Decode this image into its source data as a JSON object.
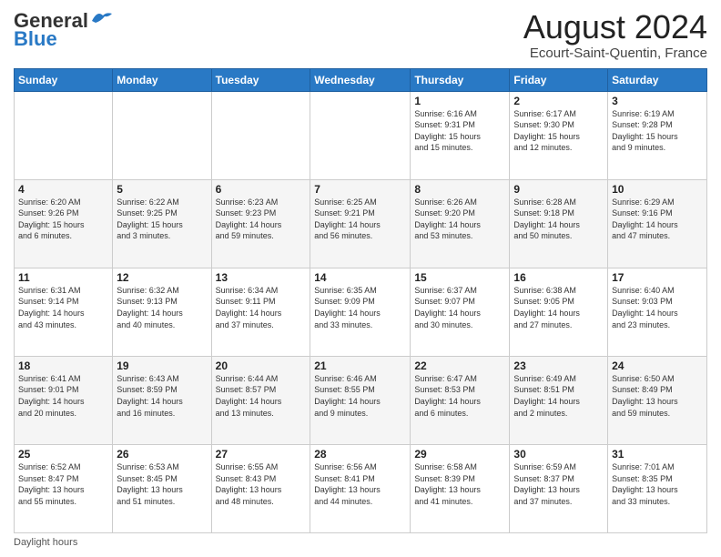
{
  "header": {
    "logo_general": "General",
    "logo_blue": "Blue",
    "month_title": "August 2024",
    "location": "Ecourt-Saint-Quentin, France"
  },
  "days_of_week": [
    "Sunday",
    "Monday",
    "Tuesday",
    "Wednesday",
    "Thursday",
    "Friday",
    "Saturday"
  ],
  "weeks": [
    [
      {
        "day": "",
        "info": ""
      },
      {
        "day": "",
        "info": ""
      },
      {
        "day": "",
        "info": ""
      },
      {
        "day": "",
        "info": ""
      },
      {
        "day": "1",
        "info": "Sunrise: 6:16 AM\nSunset: 9:31 PM\nDaylight: 15 hours\nand 15 minutes."
      },
      {
        "day": "2",
        "info": "Sunrise: 6:17 AM\nSunset: 9:30 PM\nDaylight: 15 hours\nand 12 minutes."
      },
      {
        "day": "3",
        "info": "Sunrise: 6:19 AM\nSunset: 9:28 PM\nDaylight: 15 hours\nand 9 minutes."
      }
    ],
    [
      {
        "day": "4",
        "info": "Sunrise: 6:20 AM\nSunset: 9:26 PM\nDaylight: 15 hours\nand 6 minutes."
      },
      {
        "day": "5",
        "info": "Sunrise: 6:22 AM\nSunset: 9:25 PM\nDaylight: 15 hours\nand 3 minutes."
      },
      {
        "day": "6",
        "info": "Sunrise: 6:23 AM\nSunset: 9:23 PM\nDaylight: 14 hours\nand 59 minutes."
      },
      {
        "day": "7",
        "info": "Sunrise: 6:25 AM\nSunset: 9:21 PM\nDaylight: 14 hours\nand 56 minutes."
      },
      {
        "day": "8",
        "info": "Sunrise: 6:26 AM\nSunset: 9:20 PM\nDaylight: 14 hours\nand 53 minutes."
      },
      {
        "day": "9",
        "info": "Sunrise: 6:28 AM\nSunset: 9:18 PM\nDaylight: 14 hours\nand 50 minutes."
      },
      {
        "day": "10",
        "info": "Sunrise: 6:29 AM\nSunset: 9:16 PM\nDaylight: 14 hours\nand 47 minutes."
      }
    ],
    [
      {
        "day": "11",
        "info": "Sunrise: 6:31 AM\nSunset: 9:14 PM\nDaylight: 14 hours\nand 43 minutes."
      },
      {
        "day": "12",
        "info": "Sunrise: 6:32 AM\nSunset: 9:13 PM\nDaylight: 14 hours\nand 40 minutes."
      },
      {
        "day": "13",
        "info": "Sunrise: 6:34 AM\nSunset: 9:11 PM\nDaylight: 14 hours\nand 37 minutes."
      },
      {
        "day": "14",
        "info": "Sunrise: 6:35 AM\nSunset: 9:09 PM\nDaylight: 14 hours\nand 33 minutes."
      },
      {
        "day": "15",
        "info": "Sunrise: 6:37 AM\nSunset: 9:07 PM\nDaylight: 14 hours\nand 30 minutes."
      },
      {
        "day": "16",
        "info": "Sunrise: 6:38 AM\nSunset: 9:05 PM\nDaylight: 14 hours\nand 27 minutes."
      },
      {
        "day": "17",
        "info": "Sunrise: 6:40 AM\nSunset: 9:03 PM\nDaylight: 14 hours\nand 23 minutes."
      }
    ],
    [
      {
        "day": "18",
        "info": "Sunrise: 6:41 AM\nSunset: 9:01 PM\nDaylight: 14 hours\nand 20 minutes."
      },
      {
        "day": "19",
        "info": "Sunrise: 6:43 AM\nSunset: 8:59 PM\nDaylight: 14 hours\nand 16 minutes."
      },
      {
        "day": "20",
        "info": "Sunrise: 6:44 AM\nSunset: 8:57 PM\nDaylight: 14 hours\nand 13 minutes."
      },
      {
        "day": "21",
        "info": "Sunrise: 6:46 AM\nSunset: 8:55 PM\nDaylight: 14 hours\nand 9 minutes."
      },
      {
        "day": "22",
        "info": "Sunrise: 6:47 AM\nSunset: 8:53 PM\nDaylight: 14 hours\nand 6 minutes."
      },
      {
        "day": "23",
        "info": "Sunrise: 6:49 AM\nSunset: 8:51 PM\nDaylight: 14 hours\nand 2 minutes."
      },
      {
        "day": "24",
        "info": "Sunrise: 6:50 AM\nSunset: 8:49 PM\nDaylight: 13 hours\nand 59 minutes."
      }
    ],
    [
      {
        "day": "25",
        "info": "Sunrise: 6:52 AM\nSunset: 8:47 PM\nDaylight: 13 hours\nand 55 minutes."
      },
      {
        "day": "26",
        "info": "Sunrise: 6:53 AM\nSunset: 8:45 PM\nDaylight: 13 hours\nand 51 minutes."
      },
      {
        "day": "27",
        "info": "Sunrise: 6:55 AM\nSunset: 8:43 PM\nDaylight: 13 hours\nand 48 minutes."
      },
      {
        "day": "28",
        "info": "Sunrise: 6:56 AM\nSunset: 8:41 PM\nDaylight: 13 hours\nand 44 minutes."
      },
      {
        "day": "29",
        "info": "Sunrise: 6:58 AM\nSunset: 8:39 PM\nDaylight: 13 hours\nand 41 minutes."
      },
      {
        "day": "30",
        "info": "Sunrise: 6:59 AM\nSunset: 8:37 PM\nDaylight: 13 hours\nand 37 minutes."
      },
      {
        "day": "31",
        "info": "Sunrise: 7:01 AM\nSunset: 8:35 PM\nDaylight: 13 hours\nand 33 minutes."
      }
    ]
  ],
  "footer": {
    "daylight_label": "Daylight hours"
  }
}
